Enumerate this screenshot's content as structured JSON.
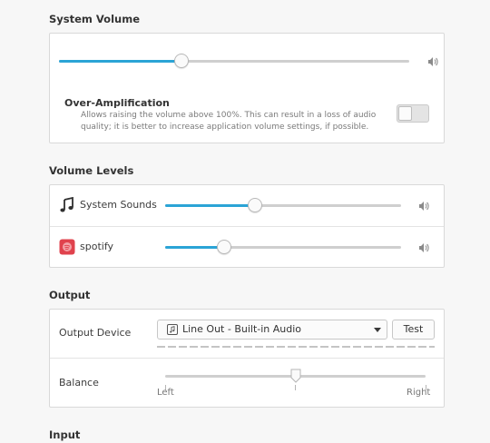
{
  "system_volume": {
    "title": "System Volume",
    "level": 0.35,
    "over_amplification": {
      "label": "Over-Amplification",
      "description_line1": "Allows raising the volume above 100%. This can result in a loss of audio",
      "description_line2": "quality; it is better to increase application volume settings, if possible.",
      "enabled": false
    }
  },
  "volume_levels": {
    "title": "Volume Levels",
    "items": [
      {
        "label": "System Sounds",
        "icon": "music-note-icon",
        "level": 0.38
      },
      {
        "label": "spotify",
        "icon": "spotify-icon",
        "level": 0.25
      }
    ]
  },
  "output": {
    "title": "Output",
    "device_label": "Output Device",
    "device_value": "Line Out - Built-in Audio",
    "test_label": "Test",
    "balance_label": "Balance",
    "balance_left": "Left",
    "balance_right": "Right",
    "balance": 0.5
  },
  "input": {
    "title": "Input"
  },
  "colors": {
    "accent": "#2ba4d6",
    "spotify_red": "#e0424d"
  }
}
